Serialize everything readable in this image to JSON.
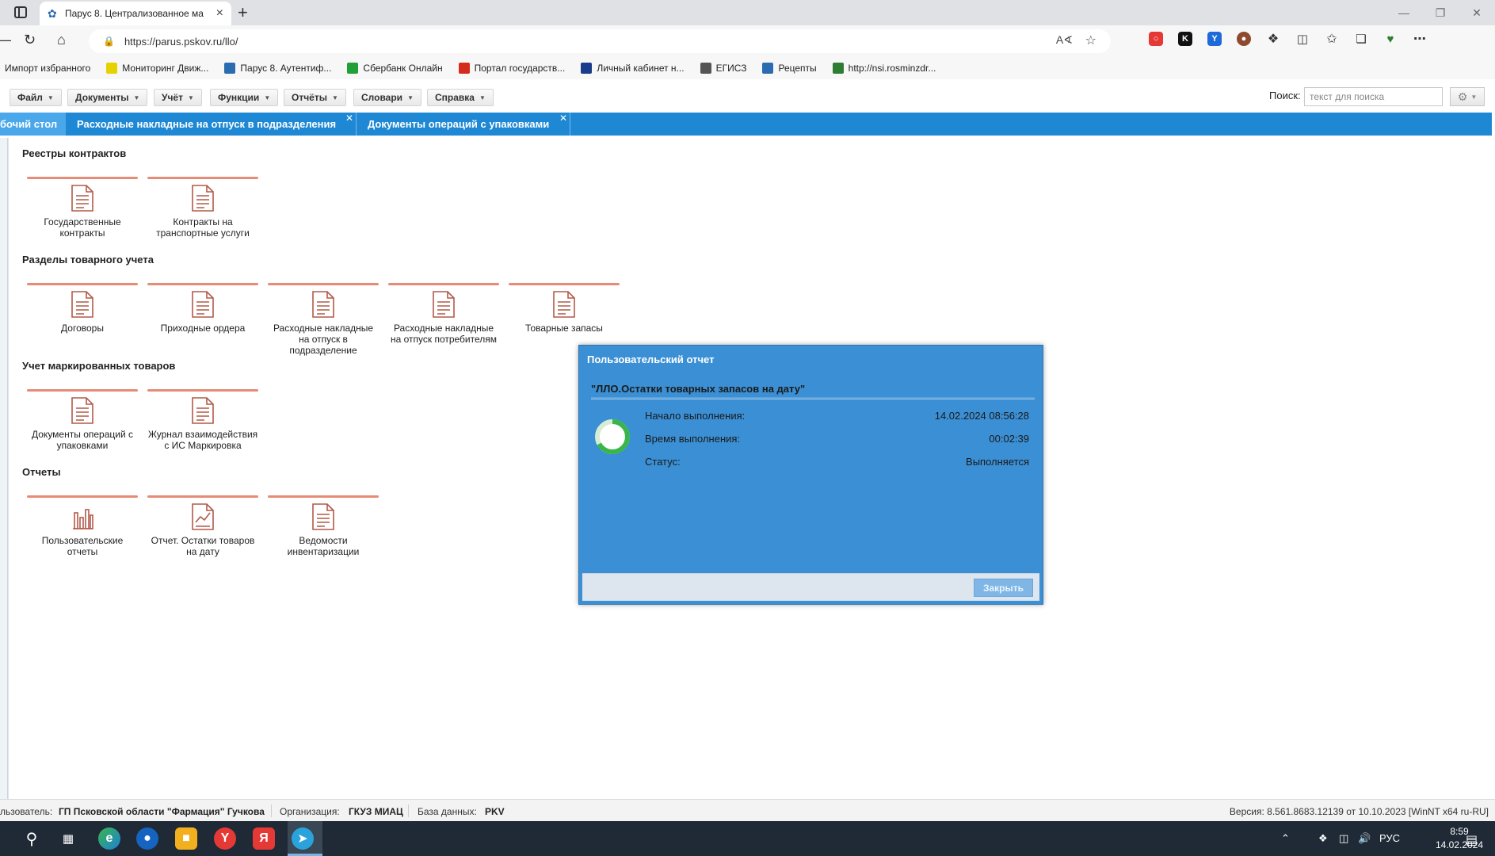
{
  "browser": {
    "tab_title": "Парус 8. Централизованное ма",
    "url": "https://parus.pskov.ru/llo/",
    "bookmarks": [
      {
        "label": "Импорт избранного",
        "icon": "none",
        "color": ""
      },
      {
        "label": "Мониторинг Движ...",
        "icon": "monitoring-icon",
        "color": "#e5d200"
      },
      {
        "label": "Парус 8. Аутентиф...",
        "icon": "parus-icon",
        "color": "#2b6cb0"
      },
      {
        "label": "Сбербанк Онлайн",
        "icon": "sber-icon",
        "color": "#21a038"
      },
      {
        "label": "Портал государств...",
        "icon": "gosuslugi-icon",
        "color": "#d52b1e"
      },
      {
        "label": "Личный кабинет н...",
        "icon": "cabinet-icon",
        "color": "#1a3c8c"
      },
      {
        "label": "ЕГИСЗ",
        "icon": "document-icon",
        "color": "#555555"
      },
      {
        "label": "Рецепты",
        "icon": "parus-icon",
        "color": "#2b6cb0"
      },
      {
        "label": "http://nsi.rosminzdr...",
        "icon": "shield-icon",
        "color": "#2e7d32"
      }
    ]
  },
  "menu": {
    "items": [
      "Файл",
      "Документы",
      "Учёт",
      "Функции",
      "Отчёты",
      "Словари",
      "Справка"
    ],
    "search_label": "Поиск:",
    "search_placeholder": "текст для поиска"
  },
  "app_tabs": [
    {
      "label": "бочий стол",
      "closable": false
    },
    {
      "label": "Расходные накладные на отпуск в подразделения",
      "closable": true
    },
    {
      "label": "Документы операций с упаковками",
      "closable": true
    }
  ],
  "sections": [
    {
      "title": "Реестры контрактов",
      "tiles": [
        {
          "label": "Государственные контракты",
          "icon": "document-icon"
        },
        {
          "label": "Контракты на транспортные услуги",
          "icon": "document-icon"
        }
      ]
    },
    {
      "title": "Разделы товарного учета",
      "tiles": [
        {
          "label": "Договоры",
          "icon": "document-icon"
        },
        {
          "label": "Приходные ордера",
          "icon": "document-icon"
        },
        {
          "label": "Расходные накладные на отпуск в подразделение",
          "icon": "document-icon"
        },
        {
          "label": "Расходные накладные на отпуск потребителям",
          "icon": "document-icon"
        },
        {
          "label": "Товарные запасы",
          "icon": "document-icon"
        }
      ]
    },
    {
      "title": "Учет маркированных товаров",
      "tiles": [
        {
          "label": "Документы операций с упаковками",
          "icon": "document-icon"
        },
        {
          "label": "Журнал взаимодействия с ИС Маркировка",
          "icon": "document-icon"
        }
      ]
    },
    {
      "title": "Отчеты",
      "tiles": [
        {
          "label": "Пользовательские отчеты",
          "icon": "bar-chart-icon"
        },
        {
          "label": "Отчет. Остатки товаров на дату",
          "icon": "chart-document-icon"
        },
        {
          "label": "Ведомости инвентаризации",
          "icon": "document-icon"
        }
      ]
    }
  ],
  "dialog": {
    "title": "Пользовательский отчет",
    "report_name": "\"ЛЛО.Остатки товарных запасов на дату\"",
    "rows": [
      {
        "label": "Начало выполнения:",
        "value": "14.02.2024 08:56:28"
      },
      {
        "label": "Время выполнения:",
        "value": "00:02:39"
      },
      {
        "label": "Статус:",
        "value": "Выполняется"
      }
    ],
    "close_label": "Закрыть"
  },
  "statusbar": {
    "user_label": "льзователь:",
    "user_value": "ГП Псковской области \"Фармация\" Гучкова",
    "org_label": "Организация:",
    "org_value": "ГКУЗ МИАЦ",
    "db_label": "База данных:",
    "db_value": "PKV",
    "version": "Версия: 8.561.8683.12139 от 10.10.2023 [WinNT x64 ru-RU]"
  },
  "taskbar": {
    "language": "РУС",
    "time": "8:59",
    "date": "14.02.2024"
  },
  "colors": {
    "app_tab_bar": "#1e88d4",
    "tile_accent": "#e58b76",
    "dialog_bg": "#3b8fd4"
  }
}
